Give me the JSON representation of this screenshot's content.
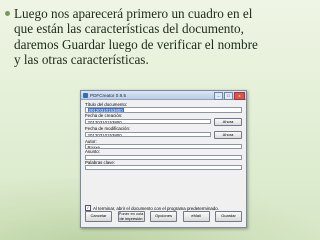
{
  "slide": {
    "lines": [
      "Luego nos aparecerá primero un cuadro en el",
      "que están las características del documento,",
      "daremos Guardar luego de verificar el nombre",
      "y las otras características."
    ]
  },
  "window": {
    "title": "PDFCreator 0.9.5",
    "controls": {
      "minimize": "–",
      "maximize": "□",
      "close": "x"
    },
    "fields": {
      "doc_title_label": "Título del documento:",
      "doc_title_value": "20120310153800",
      "created_label": "Fecha de creación:",
      "created_value": "20120310153800",
      "modified_label": "Fecha de modificación:",
      "modified_value": "20120310153800",
      "author_label": "Autor:",
      "author_value": "Roxxe",
      "subject_label": "Asunto:",
      "subject_value": "",
      "keywords_label": "Palabras clave:",
      "keywords_value": ""
    },
    "now_button": "Ahora",
    "checkbox": {
      "checked": true,
      "label": "Al terminar, abrir el documento con el programa predeterminado."
    },
    "buttons": {
      "cancel": "Cancelar",
      "queue": "Poner en cola de impresión",
      "options": "Opciones",
      "email": "eMail",
      "save": "Guardar"
    }
  }
}
